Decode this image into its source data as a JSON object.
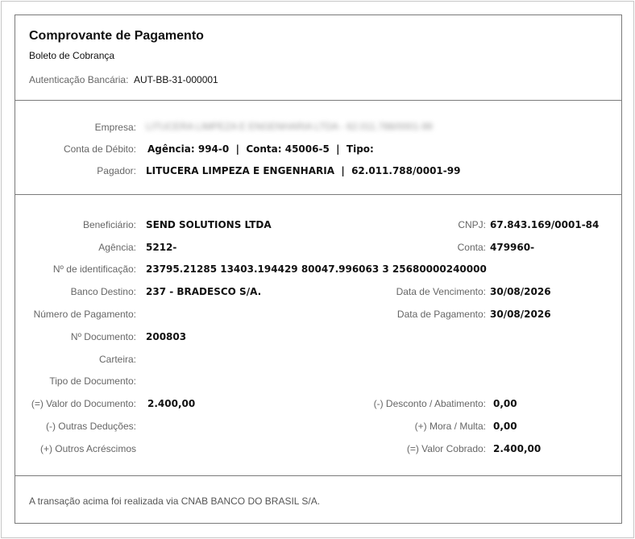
{
  "header": {
    "title": "Comprovante de Pagamento",
    "subtitle": "Boleto de Cobrança",
    "auth_label": "Autenticação Bancária:",
    "auth_value": "AUT-BB-31-000001"
  },
  "payer": {
    "empresa_label": "Empresa:",
    "empresa_value": "LITUCERA LIMPEZA E ENGENHARIA LTDA - 62.011.788/0001-99",
    "conta_label": "Conta de Débito:",
    "conta_value": "Agência: 994-0  |  Conta: 45006-5  |  Tipo:",
    "pagador_label": "Pagador:",
    "pagador_value": "LITUCERA LIMPEZA E ENGENHARIA  |  62.011.788/0001-99"
  },
  "details": {
    "beneficiario_label": "Beneficiário:",
    "beneficiario_value": "SEND SOLUTIONS LTDA",
    "cnpj_label": "CNPJ:",
    "cnpj_value": "67.843.169/0001-84",
    "agencia_label": "Agência:",
    "agencia_value": "5212-",
    "conta_label": "Conta:",
    "conta_value": "479960-",
    "identificacao_label": "Nº de identificação:",
    "identificacao_value": "23795.21285 13403.194429 80047.996063 3 25680000240000",
    "banco_label": "Banco Destino:",
    "banco_value": "237 - BRADESCO S/A.",
    "vencimento_label": "Data de Vencimento:",
    "vencimento_value": "30/08/2026",
    "numero_pagamento_label": "Número de Pagamento:",
    "data_pagamento_label": "Data de Pagamento:",
    "data_pagamento_value": "30/08/2026",
    "documento_label": "Nº Documento:",
    "documento_value": "200803",
    "carteira_label": "Carteira:",
    "tipo_documento_label": "Tipo de Documento:",
    "valor_documento_label": "(=) Valor do Documento:",
    "valor_documento_value": "2.400,00",
    "desconto_label": "(-) Desconto / Abatimento:",
    "desconto_value": "0,00",
    "outras_deducoes_label": "(-) Outras Deduções:",
    "mora_label": "(+) Mora / Multa:",
    "mora_value": "0,00",
    "outros_acrescimos_label": "(+) Outros Acréscimos",
    "valor_cobrado_label": "(=) Valor Cobrado:",
    "valor_cobrado_value": "2.400,00"
  },
  "footer": {
    "note": "A transação acima foi realizada via CNAB BANCO DO BRASIL S/A."
  }
}
